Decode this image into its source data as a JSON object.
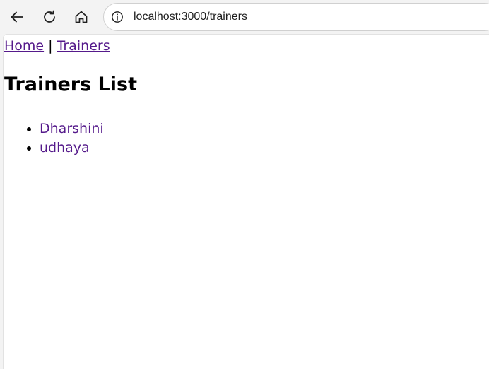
{
  "browser": {
    "url": "localhost:3000/trainers",
    "icons": [
      "back-arrow-icon",
      "reload-icon",
      "home-icon",
      "info-icon"
    ]
  },
  "page": {
    "nav": {
      "home_label": "Home",
      "separator": "|",
      "trainers_label": "Trainers"
    },
    "heading": "Trainers List",
    "trainers": [
      {
        "name": "Dharshini"
      },
      {
        "name": "udhaya"
      }
    ],
    "colors": {
      "link": "#551a8b",
      "page_background": "#ffffff",
      "chrome_background": "#f3f3f3"
    }
  }
}
